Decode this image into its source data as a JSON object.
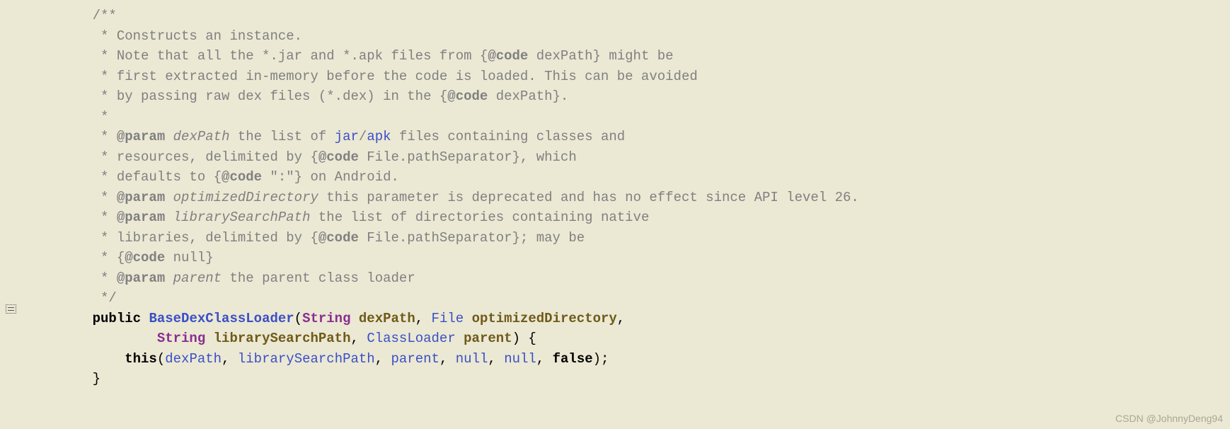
{
  "lines": {
    "l1": "    /**",
    "l2a": "     * Constructs an instance.",
    "l3a": "     * Note that all the *.jar and *.apk files from {",
    "l3b": "@code",
    "l3c": " dexPath} might be",
    "l4": "     * first extracted in-memory before the code is loaded. This can be avoided",
    "l5a": "     * by passing raw dex files (*.dex) in the {",
    "l5b": "@code",
    "l5c": " dexPath}.",
    "l6": "     *",
    "l7a": "     * ",
    "l7b": "@param",
    "l7c": " dexPath",
    "l7d": " the list of ",
    "l7e": "jar",
    "l7f": "/",
    "l7g": "apk",
    "l7h": " files containing classes and",
    "l8a": "     * resources, delimited by {",
    "l8b": "@code",
    "l8c": " File.pathSeparator}, which",
    "l9a": "     * defaults to {",
    "l9b": "@code",
    "l9c": " \":\"} on Android.",
    "l10a": "     * ",
    "l10b": "@param",
    "l10c": " optimizedDirectory",
    "l10d": " this parameter is deprecated and has no effect since API level 26.",
    "l11a": "     * ",
    "l11b": "@param",
    "l11c": " librarySearchPath",
    "l11d": " the list of directories containing native",
    "l12a": "     * libraries, delimited by {",
    "l12b": "@code",
    "l12c": " File.pathSeparator}; may be",
    "l13a": "     * {",
    "l13b": "@code",
    "l13c": " null}",
    "l14a": "     * ",
    "l14b": "@param",
    "l14c": " parent",
    "l14d": " the parent class loader",
    "l15": "     */",
    "l16_kw": "public",
    "l16_sp": " ",
    "l16_method": "BaseDexClassLoader",
    "l16_paren": "(",
    "l16_t1": "String",
    "l16_sp2": " ",
    "l16_p1": "dexPath",
    "l16_comma": ", ",
    "l16_t2": "File",
    "l16_sp3": " ",
    "l16_p2": "optimizedDirectory",
    "l16_end": ",",
    "l17_indent": "            ",
    "l17_t1": "String",
    "l17_sp": " ",
    "l17_p1": "librarySearchPath",
    "l17_comma": ", ",
    "l17_t2": "ClassLoader",
    "l17_sp2": " ",
    "l17_p2": "parent",
    "l17_end": ") {",
    "l18_indent": "        ",
    "l18_this": "this",
    "l18_open": "(",
    "l18_a1": "dexPath",
    "l18_c1": ", ",
    "l18_a2": "librarySearchPath",
    "l18_c2": ", ",
    "l18_a3": "parent",
    "l18_c3": ", ",
    "l18_a4": "null",
    "l18_c4": ", ",
    "l18_a5": "null",
    "l18_c5": ", ",
    "l18_a6": "false",
    "l18_close": ");",
    "l19": "    }"
  },
  "watermark": "CSDN @JohnnyDeng94"
}
